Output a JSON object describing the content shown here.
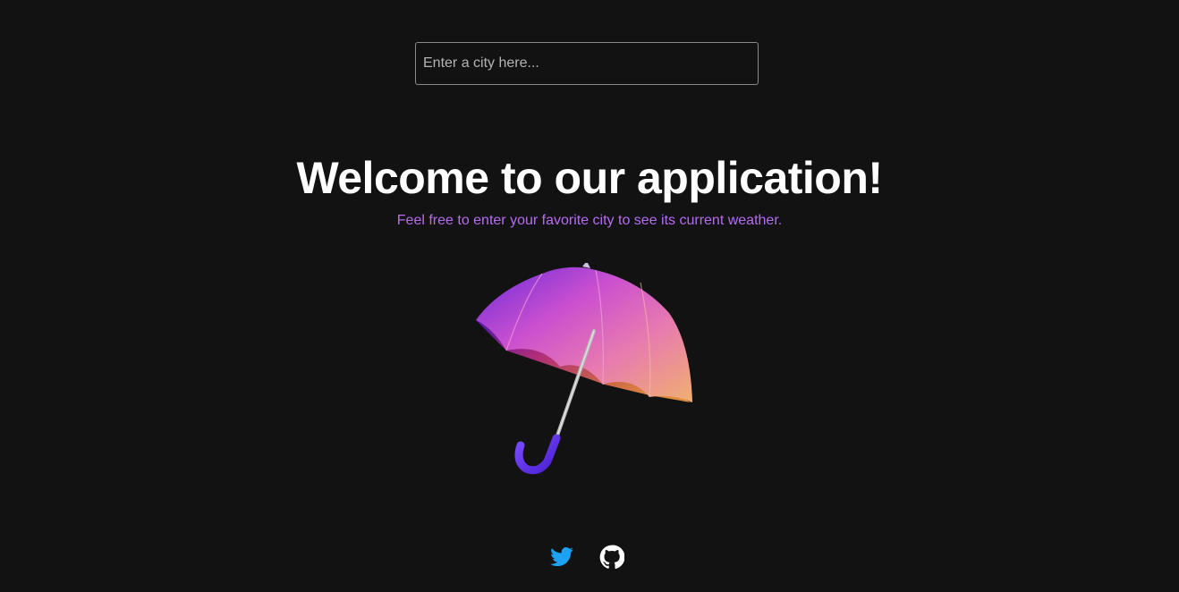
{
  "search": {
    "placeholder": "Enter a city here..."
  },
  "hero": {
    "headline": "Welcome to our application!",
    "subtitle": "Feel free to enter your favorite city to see its current weather."
  },
  "illustration": {
    "icon": "umbrella-icon"
  },
  "footer": {
    "links": [
      {
        "icon": "twitter-icon",
        "color": "#1da1f2"
      },
      {
        "icon": "github-icon",
        "color": "#ffffff"
      }
    ]
  },
  "colors": {
    "background": "#121212",
    "accent": "#b56cf2",
    "headline": "#ffffff",
    "input_border": "#8a8a8a"
  }
}
